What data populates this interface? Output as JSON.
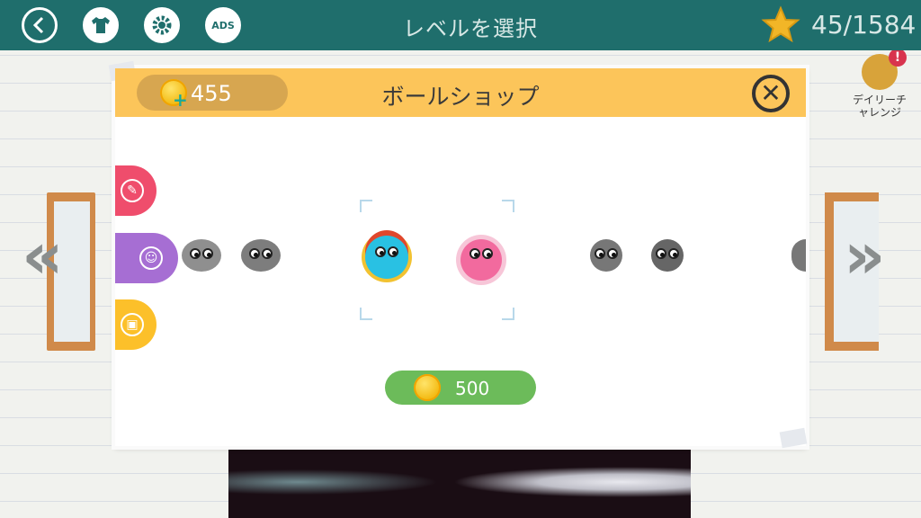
{
  "topbar": {
    "title": "レベルを選択",
    "score": "45/1584",
    "icons": [
      "back-icon",
      "shirt-icon",
      "gear-icon",
      "ads-icon",
      "star-icon"
    ],
    "ads_label": "ADS"
  },
  "daily_challenge": {
    "label_line1": "デイリーチ",
    "label_line2": "ャレンジ",
    "badge": "!"
  },
  "navigation": {
    "prev": "«",
    "next": "»"
  },
  "dialog": {
    "title": "ボールショップ",
    "coins": "455",
    "close": "✕",
    "categories": [
      {
        "name": "pen",
        "color": "#ef4d6c",
        "icon": "✎"
      },
      {
        "name": "smiley",
        "color": "#a66ed3",
        "icon": "☺"
      },
      {
        "name": "image",
        "color": "#fcc02a",
        "icon": "▣"
      }
    ],
    "buy_price": "500"
  },
  "colors": {
    "topbar": "#1f6e6c",
    "header": "#fcc55a",
    "buy_button": "#6cbb5a",
    "coin": "#f2b80e"
  }
}
